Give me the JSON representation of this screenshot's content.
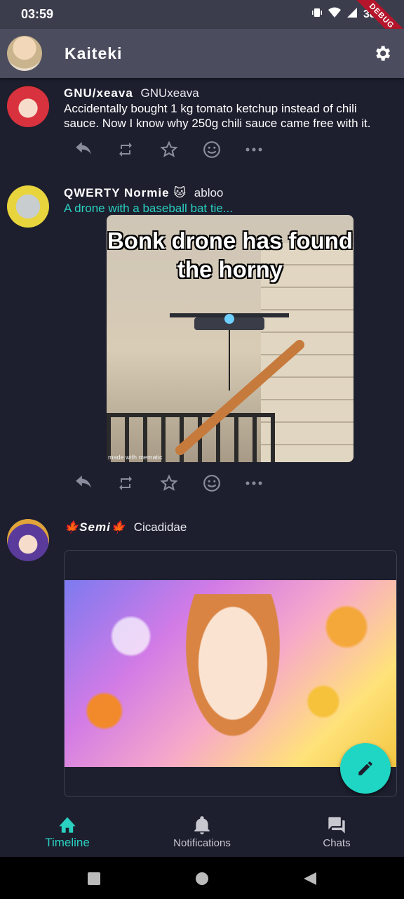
{
  "status_bar": {
    "time": "03:59",
    "battery": "38%",
    "debug_banner": "DEBUG"
  },
  "app_bar": {
    "title": "Kaiteki"
  },
  "posts": [
    {
      "display_name": "GNU/xeava",
      "handle": "GNUxeava",
      "content": "Accidentally bought 1 kg tomato ketchup instead of chili sauce. Now I know why 250g chili sauce came free with it."
    },
    {
      "display_name": "QWERTY Normie 🐱",
      "handle": "abloo",
      "content_warning": "A drone with a baseball bat tie...",
      "media_text": "Bonk drone has found the horny",
      "media_watermark": "made with mematic"
    },
    {
      "display_name": "🍁Semi🍁",
      "handle": "Cicadidae"
    }
  ],
  "bottom_nav": {
    "items": [
      {
        "label": "Timeline",
        "icon": "home-icon",
        "active": true
      },
      {
        "label": "Notifications",
        "icon": "bell-icon",
        "active": false
      },
      {
        "label": "Chats",
        "icon": "chat-icon",
        "active": false
      }
    ]
  },
  "colors": {
    "background": "#1d1f2e",
    "app_bar": "#4b4c5d",
    "accent": "#2ad0c0",
    "fab": "#1fd6c4"
  }
}
